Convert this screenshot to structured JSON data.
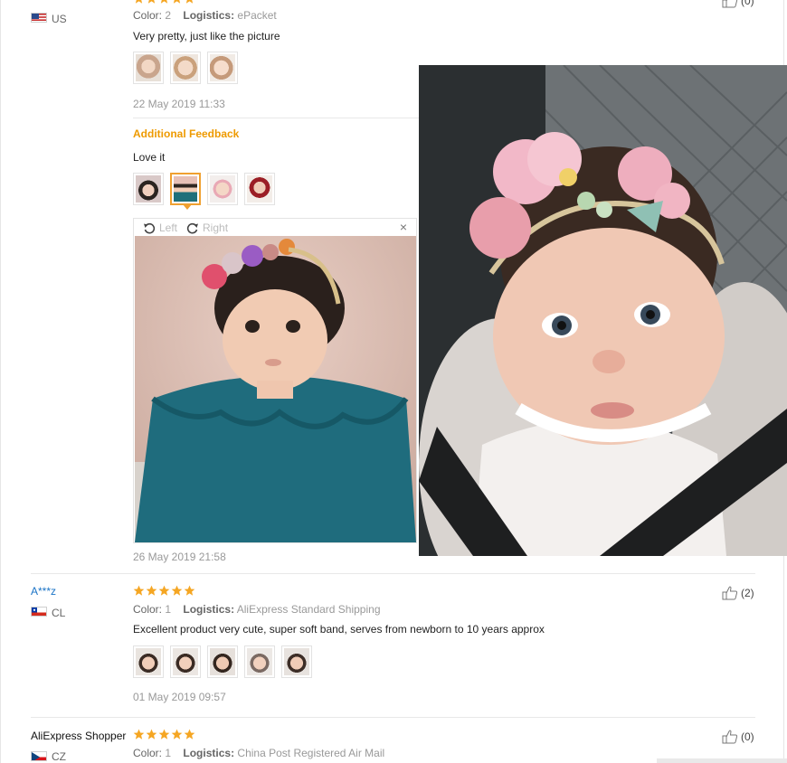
{
  "review1": {
    "country": "US",
    "color_label": "Color:",
    "color_value": "2",
    "logistics_label": "Logistics:",
    "logistics_value": "ePacket",
    "text": "Very pretty, just like the picture",
    "date": "22 May 2019 11:33",
    "helpful_count": "(0)",
    "additional_label": "Additional Feedback",
    "additional_text": "Love it",
    "additional_date": "26 May 2019 21:58",
    "viewer": {
      "left_label": "Left",
      "right_label": "Right",
      "close": "×"
    }
  },
  "review2": {
    "name": "A***z",
    "country": "CL",
    "color_label": "Color:",
    "color_value": "1",
    "logistics_label": "Logistics:",
    "logistics_value": "AliExpress Standard Shipping",
    "text": "Excellent product very cute, super soft band, serves from newborn to 10 years approx",
    "date": "01 May 2019 09:57",
    "helpful_count": "(2)",
    "rating_stars": 5
  },
  "review3": {
    "name": "AliExpress Shopper",
    "country": "CZ",
    "color_label": "Color:",
    "color_value": "1",
    "logistics_label": "Logistics:",
    "logistics_value": "China Post Registered Air Mail",
    "helpful_count": "(0)",
    "rating_stars": 5
  },
  "colors": {
    "star": "#f5a623",
    "link": "#1a73c6",
    "accent": "#ee9a00"
  },
  "icons": [
    "thumbs-up-icon",
    "star-icon",
    "rotate-left-icon",
    "rotate-right-icon",
    "close-icon",
    "flag-us-icon",
    "flag-cl-icon",
    "flag-cz-icon"
  ]
}
